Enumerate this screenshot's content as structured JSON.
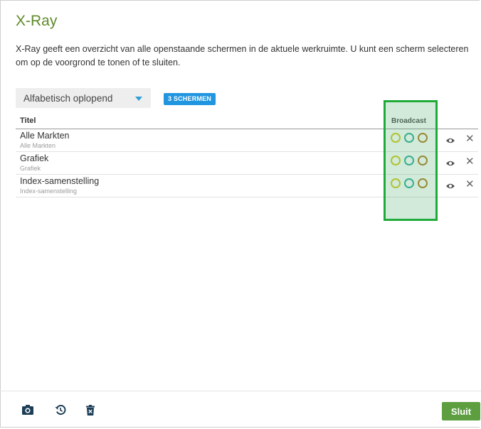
{
  "dialog": {
    "title": "X-Ray",
    "description": "X-Ray geeft een overzicht van alle openstaande schermen in de aktuele werkruimte. U kunt een scherm selecteren om op de voorgrond te tonen of te sluiten."
  },
  "toolbar": {
    "sort_label": "Alfabetisch oplopend",
    "count_badge": "3 SCHERMEN"
  },
  "table": {
    "headers": {
      "title": "Titel",
      "broadcast": "Broadcast"
    },
    "rows": [
      {
        "name": "Alle Markten",
        "sub": "Alle Markten"
      },
      {
        "name": "Grafiek",
        "sub": "Grafiek"
      },
      {
        "name": "Index-samenstelling",
        "sub": "Index-samenstelling"
      }
    ]
  },
  "broadcast_colors": {
    "yellow": "#d6cd2a",
    "teal": "#3fb3a1",
    "brown": "#b7842f"
  },
  "footer": {
    "icons": [
      "camera-icon",
      "restore-icon",
      "delete-icon"
    ],
    "close_label": "Sluit"
  },
  "colors": {
    "title": "#5f8a2a",
    "badge": "#2196e0",
    "primary_button": "#5c9e40",
    "highlight": "#1faa3a"
  }
}
